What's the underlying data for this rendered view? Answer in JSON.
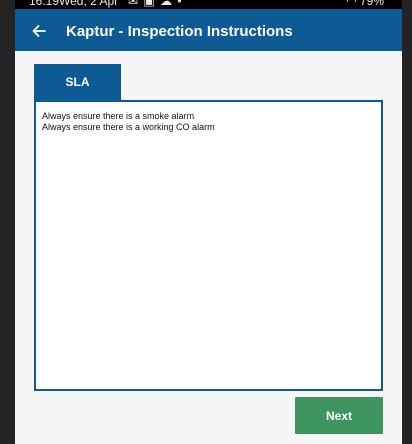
{
  "status_bar": {
    "time": "16:19",
    "date": "Wed, 2 Apr",
    "notification_icons": [
      "mail-icon",
      "image-icon",
      "cloud-icon",
      "dot-icon"
    ],
    "battery": "79%"
  },
  "app_bar": {
    "title": "Kaptur - Inspection Instructions",
    "back_icon": "arrow-left-icon",
    "color": "#0d5a95"
  },
  "tabs": [
    {
      "label": "SLA",
      "active": true
    }
  ],
  "instructions": {
    "lines": [
      "Always ensure there is a smoke alarm",
      "Always ensure there is a working CO alarm"
    ]
  },
  "actions": {
    "next_label": "Next",
    "next_color": "#3e955f"
  }
}
